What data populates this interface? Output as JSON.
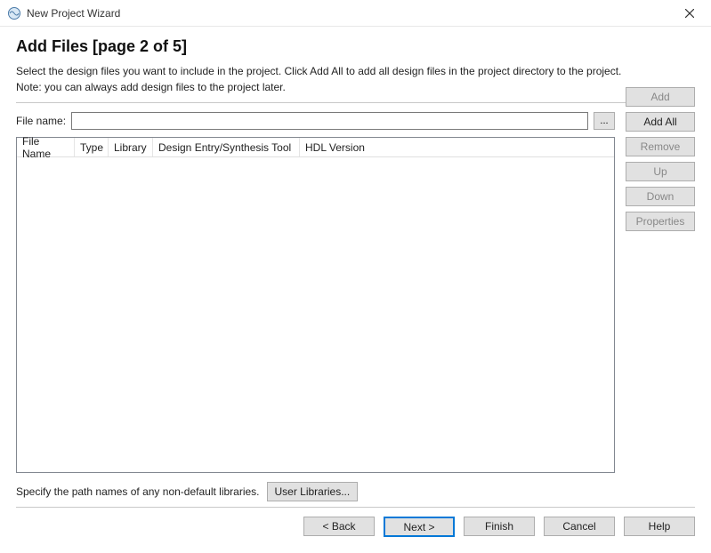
{
  "window": {
    "title": "New Project Wizard"
  },
  "page": {
    "heading": "Add Files [page 2 of 5]",
    "description_line1": "Select the design files you want to include in the project. Click Add All to add all design files in the project directory to the project.",
    "description_line2": "Note: you can always add design files to the project later."
  },
  "filename": {
    "label": "File name:",
    "value": "",
    "browse_label": "..."
  },
  "table": {
    "columns": {
      "filename": "File Name",
      "type": "Type",
      "library": "Library",
      "tool": "Design Entry/Synthesis Tool",
      "hdl": "HDL Version"
    }
  },
  "side_buttons": {
    "add": "Add",
    "add_all": "Add All",
    "remove": "Remove",
    "up": "Up",
    "down": "Down",
    "properties": "Properties"
  },
  "libraries": {
    "desc": "Specify the path names of any non-default libraries.",
    "button": "User Libraries..."
  },
  "footer": {
    "back": "< Back",
    "next": "Next >",
    "finish": "Finish",
    "cancel": "Cancel",
    "help": "Help"
  }
}
